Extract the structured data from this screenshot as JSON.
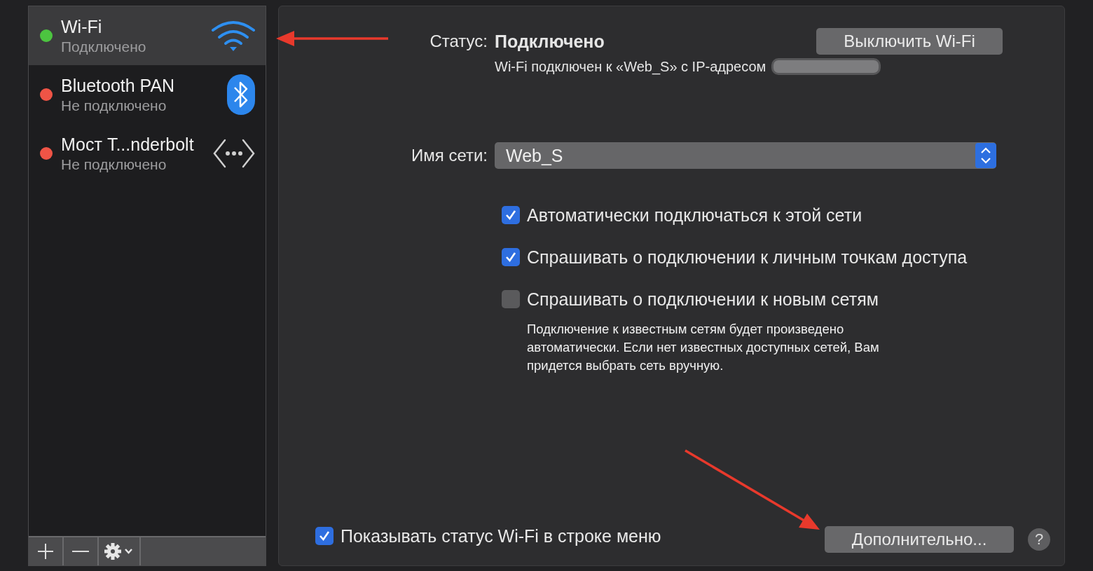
{
  "sidebar": {
    "items": [
      {
        "name": "Wi-Fi",
        "status": "Подключено",
        "color": "#4cc440",
        "kind": "wifi",
        "selected": true
      },
      {
        "name": "Bluetooth PAN",
        "status": "Не подключено",
        "color": "#ef5446",
        "kind": "bluetooth",
        "selected": false
      },
      {
        "name": "Мост T...nderbolt",
        "status": "Не подключено",
        "color": "#ef5446",
        "kind": "bridge",
        "selected": false
      }
    ]
  },
  "status": {
    "label": "Статус:",
    "value": "Подключено",
    "detail": "Wi-Fi подключен к «Web_S» с IP-адресом",
    "toggle_button": "Выключить Wi-Fi"
  },
  "network": {
    "label": "Имя сети:",
    "value": "Web_S"
  },
  "options": [
    {
      "label": "Автоматически подключаться к этой сети",
      "checked": true
    },
    {
      "label": "Спрашивать о подключении к личным точкам доступа",
      "checked": true
    },
    {
      "label": "Спрашивать о подключении к новым сетям",
      "checked": false
    }
  ],
  "note": "Подключение к известным сетям будет произведено автоматически. Если нет известных доступных сетей, Вам придется выбрать сеть вручную.",
  "show_in_menu_bar": {
    "label": "Показывать статус Wi-Fi в строке меню",
    "checked": true
  },
  "advanced_button": "Дополнительно...",
  "help_button": "?"
}
